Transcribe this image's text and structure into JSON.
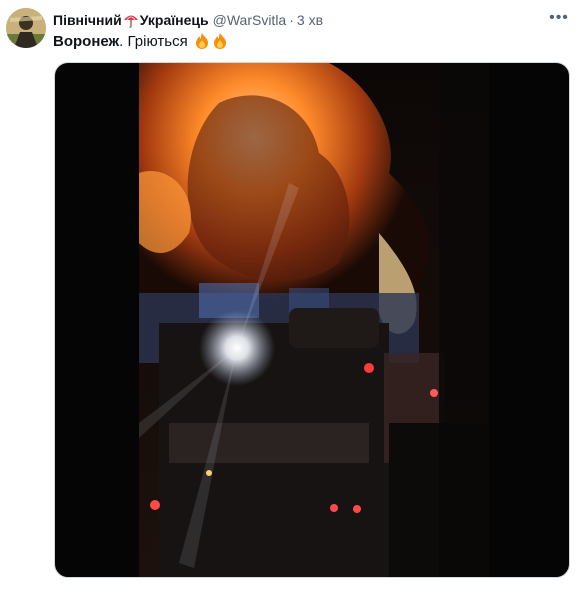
{
  "author": {
    "name_part1": "Північний",
    "name_part2": "Українець",
    "handle": "@WarSvitla",
    "separator": "·",
    "time": "3 хв",
    "avatar_icon": "avatar-icon",
    "name_emoji": "umbrella-icon"
  },
  "tweet": {
    "text_bold": "Воронеж",
    "text_rest": ". Гріються",
    "emoji": [
      "fire-icon",
      "fire-icon"
    ]
  },
  "more_menu": {
    "label": "•••"
  },
  "media": {
    "type": "video",
    "accent": "#ff7a1a"
  }
}
